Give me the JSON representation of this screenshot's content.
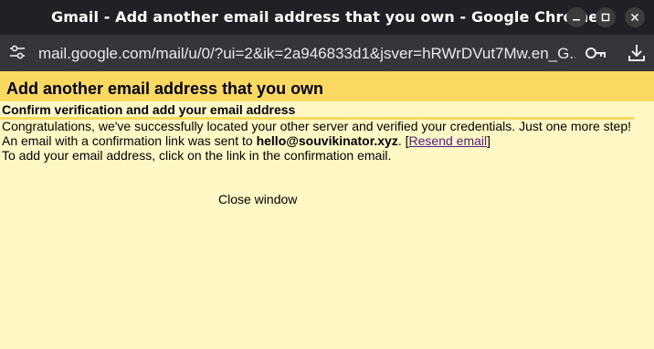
{
  "window": {
    "title": "Gmail - Add another email address that you own - Google Chrome",
    "minimize_icon": "minimize-icon",
    "maximize_icon": "maximize-icon",
    "close_icon": "close-icon"
  },
  "address_bar": {
    "url": "mail.google.com/mail/u/0/?ui=2&ik=2a946833d1&jsver=hRWrDVut7Mw.en_G...",
    "site_info_icon": "tune-icon",
    "key_icon": "key-icon",
    "download_icon": "download-icon"
  },
  "dialog": {
    "heading": "Add another email address that you own",
    "subheading": "Confirm verification and add your email address",
    "message_line1": "Congratulations, we've successfully located your other server and verified your credentials. Just one more step!",
    "message_line2_prefix": "An email with a confirmation link was sent to ",
    "email": "hello@souvikinator.xyz",
    "message_line2_suffix": ". [",
    "resend_link": "Resend email",
    "message_line2_end": "]",
    "message_line3": "To add your email address, click on the link in the confirmation email.",
    "close_window": "Close window"
  },
  "colors": {
    "page_background": "#fff8c4",
    "header_band": "#fad961",
    "link": "#551a8b",
    "titlebar": "#202124",
    "addressbar": "#35363a"
  }
}
